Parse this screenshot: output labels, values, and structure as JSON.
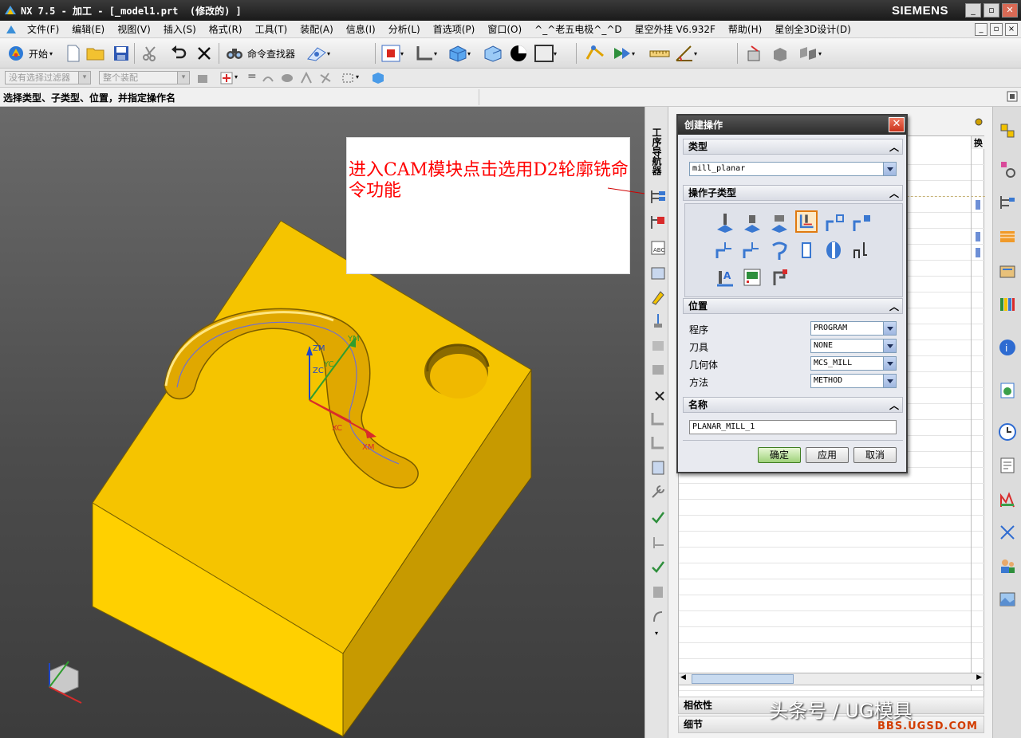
{
  "window": {
    "title": "NX 7.5 - 加工 - [_model1.prt  (修改的) ]",
    "brand": "SIEMENS"
  },
  "menubar": {
    "items": [
      "文件(F)",
      "编辑(E)",
      "视图(V)",
      "插入(S)",
      "格式(R)",
      "工具(T)",
      "装配(A)",
      "信息(I)",
      "分析(L)",
      "首选项(P)",
      "窗口(O)",
      "^_^老五电极^_^D",
      "星空外挂 V6.932F",
      "帮助(H)",
      "星创全3D设计(D)"
    ]
  },
  "toolbar": {
    "start_label": "开始",
    "command_finder_label": "命令查找器"
  },
  "filterbar": {
    "selection_filter": "没有选择过滤器",
    "assembly_scope": "整个装配"
  },
  "status": {
    "prompt": "选择类型、子类型、位置，并指定操作名"
  },
  "viewport": {
    "annotation": "进入CAM模块点击选用D2轮廓铣命令功能",
    "axes": {
      "zm": "ZM",
      "zc": "ZC",
      "yc": "YC",
      "ym": "YM",
      "xc": "XC",
      "xm": "XM"
    }
  },
  "resource_bar": {
    "label": "工序导航器"
  },
  "navigator": {
    "col_header": "换",
    "related_label": "相依性",
    "details_label": "细节"
  },
  "dialog": {
    "title": "创建操作",
    "type_section": "类型",
    "type_value": "mill_planar",
    "subtype_section": "操作子类型",
    "location_section": "位置",
    "fields": [
      {
        "label": "程序",
        "value": "PROGRAM"
      },
      {
        "label": "刀具",
        "value": "NONE"
      },
      {
        "label": "几何体",
        "value": "MCS_MILL"
      },
      {
        "label": "方法",
        "value": "METHOD"
      }
    ],
    "name_section": "名称",
    "name_value": "PLANAR_MILL_1",
    "ok_label": "确定",
    "apply_label": "应用",
    "cancel_label": "取消"
  },
  "watermark": {
    "text": "头条号 / UG模具",
    "site": "BBS.UGSD.COM"
  },
  "colors": {
    "part": "#f5c400",
    "annotation_text": "#ff0000",
    "selected_subtype": "#e07a10"
  }
}
